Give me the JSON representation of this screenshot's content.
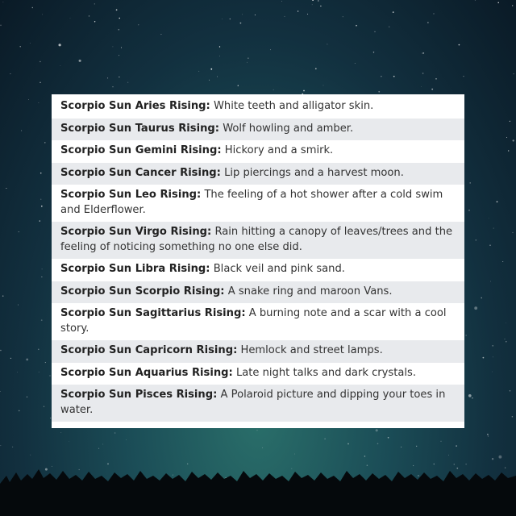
{
  "rows": [
    {
      "name": "Scorpio Sun Aries Rising:",
      "text": "White teeth and alligator skin."
    },
    {
      "name": "Scorpio Sun Taurus Rising:",
      "text": "Wolf howling and amber."
    },
    {
      "name": "Scorpio Sun Gemini Rising:",
      "text": "Hickory and a smirk."
    },
    {
      "name": "Scorpio Sun Cancer Rising:",
      "text": "Lip piercings and a harvest moon."
    },
    {
      "name": "Scorpio Sun Leo Rising:",
      "text": "The feeling of a hot shower after a cold swim and Elderflower."
    },
    {
      "name": "Scorpio Sun Virgo Rising:",
      "text": "Rain hitting a canopy of leaves/trees and the feeling of noticing something no one else did."
    },
    {
      "name": "Scorpio Sun Libra Rising:",
      "text": "Black veil and pink sand."
    },
    {
      "name": "Scorpio Sun Scorpio Rising:",
      "text": "A snake ring and maroon Vans."
    },
    {
      "name": "Scorpio Sun Sagittarius Rising:",
      "text": "A burning note and a scar with a cool story."
    },
    {
      "name": "Scorpio Sun Capricorn Rising:",
      "text": "Hemlock and street lamps."
    },
    {
      "name": "Scorpio Sun Aquarius Rising:",
      "text": "Late night talks and dark crystals."
    },
    {
      "name": "Scorpio Sun Pisces Rising:",
      "text": "A Polaroid picture and dipping your toes in water."
    }
  ]
}
